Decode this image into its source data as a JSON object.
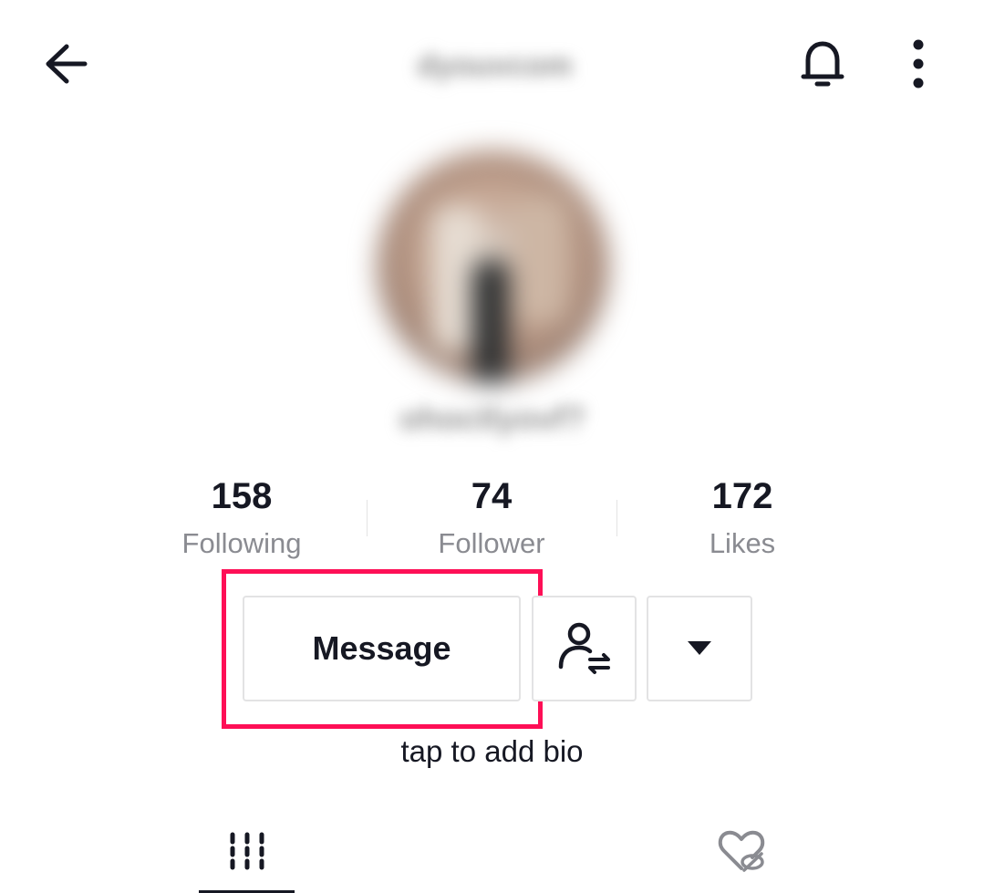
{
  "header": {
    "username": "dyouvcom",
    "icons": {
      "back": "back-arrow-icon",
      "notifications": "bell-icon",
      "more": "more-vertical-icon"
    }
  },
  "profile": {
    "handle": "ohoctlyovf?"
  },
  "stats": [
    {
      "value": "158",
      "label": "Following"
    },
    {
      "value": "74",
      "label": "Follower"
    },
    {
      "value": "172",
      "label": "Likes"
    }
  ],
  "actions": {
    "message_label": "Message",
    "icons": {
      "friends": "add-friend-swap-icon",
      "more": "caret-down-icon"
    }
  },
  "bio_prompt": "tap to add bio",
  "tabs": [
    {
      "icon": "videos-grid-icon",
      "active": true
    },
    {
      "icon": "liked-hidden-icon",
      "active": false
    }
  ],
  "colors": {
    "highlight": "#fe0f56",
    "text": "#161823",
    "muted": "#8a8b91"
  }
}
